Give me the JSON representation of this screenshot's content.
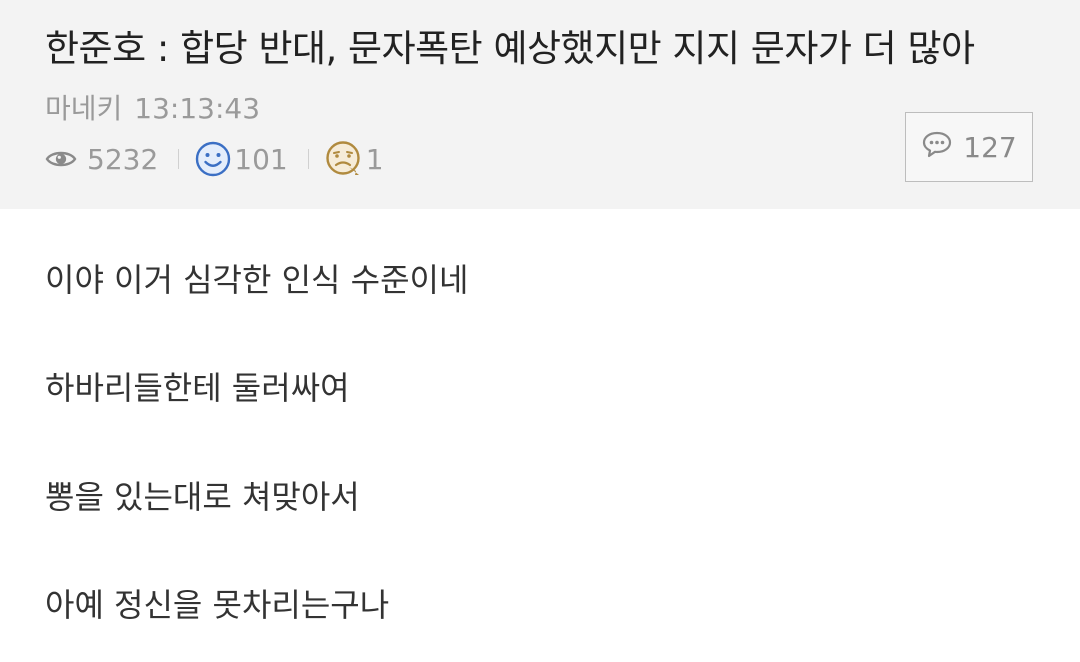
{
  "post": {
    "title": "한준호 : 합당 반대, 문자폭탄 예상했지만 지지 문자가 더 많아",
    "author": "마네키",
    "time": "13:13:43",
    "views": "5232",
    "likes": "101",
    "dislikes": "1",
    "comments": "127"
  },
  "icons": {
    "views": "eye-icon",
    "likes": "smiley-face-icon",
    "dislikes": "sad-face-icon",
    "comments": "speech-bubble-icon"
  },
  "colors": {
    "header_bg": "#f3f3f3",
    "like_blue": "#3b6fc4",
    "dislike_brown": "#b08a3e"
  },
  "body": {
    "lines": [
      "이야 이거 심각한 인식 수준이네",
      "하바리들한테 둘러싸여",
      "뽕을 있는대로 쳐맞아서",
      "아예 정신을 못차리는구나"
    ]
  }
}
